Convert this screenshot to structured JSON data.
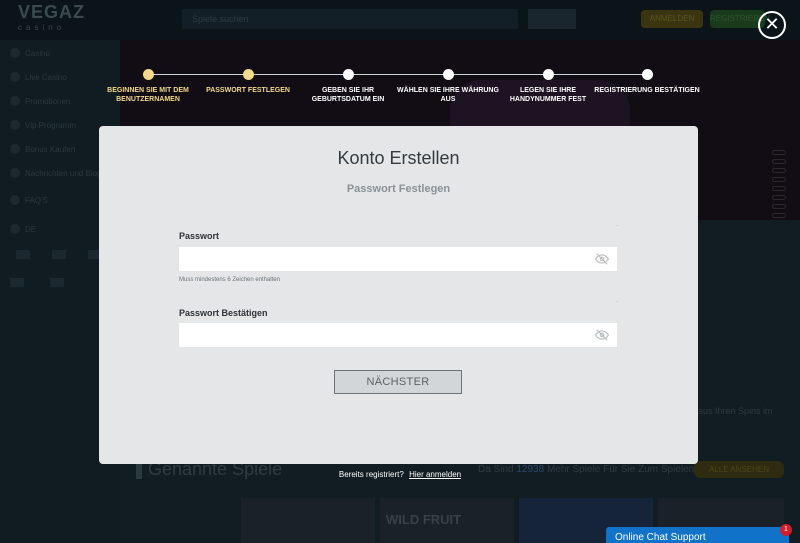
{
  "background": {
    "logo": "VEGAZ",
    "logo_sub": "casino",
    "search_placeholder": "Spiele suchen",
    "login": "ANMELDEN",
    "register": "REGISTRIEREN",
    "sidebar": [
      "Casino",
      "Live Casino",
      "Promotionen",
      "Vip Programm",
      "Bonus Kaufen",
      "Nachrichten und Blog",
      "FAQ'S"
    ],
    "language": "DE",
    "featured_title": "Genannte Spiele",
    "games_count_prefix": "Da Sind",
    "games_count_number": "12938",
    "games_count_suffix": "Mehr Spiele Für Sie Zum Spielen",
    "show_all": "ALLE ANSEHEN",
    "spins_text": "aus Ihren Spins im",
    "game_tile_text": "WILD FRUIT"
  },
  "steps": [
    {
      "label": "BEGINNEN SIE MIT DEM BENUTZERNAMEN",
      "state": "done"
    },
    {
      "label": "PASSWORT FESTLEGEN",
      "state": "done"
    },
    {
      "label": "GEBEN SIE IHR GEBURTSDATUM EIN",
      "state": "pending"
    },
    {
      "label": "WÄHLEN SIE IHRE WÄHRUNG AUS",
      "state": "pending"
    },
    {
      "label": "LEGEN SIE IHRE HANDYNUMMER FEST",
      "state": "pending"
    },
    {
      "label": "REGISTRIERUNG BESTÄTIGEN",
      "state": "pending"
    }
  ],
  "modal": {
    "title": "Konto Erstellen",
    "subtitle": "Passwort Festlegen",
    "password_label": "Passwort",
    "password_value": "",
    "password_hint": "Muss mindestens 6 Zeichen enthalten",
    "confirm_label": "Passwort Bestätigen",
    "confirm_value": "",
    "next_button": "NÄCHSTER"
  },
  "footer": {
    "already_registered": "Bereits registriert?",
    "login_link": "Hier anmelden"
  },
  "chat": {
    "label": "Online Chat Support",
    "badge": "1"
  },
  "colors": {
    "step_done": "#f3d98b",
    "chat": "#1072c8",
    "badge": "#d21d2a"
  }
}
